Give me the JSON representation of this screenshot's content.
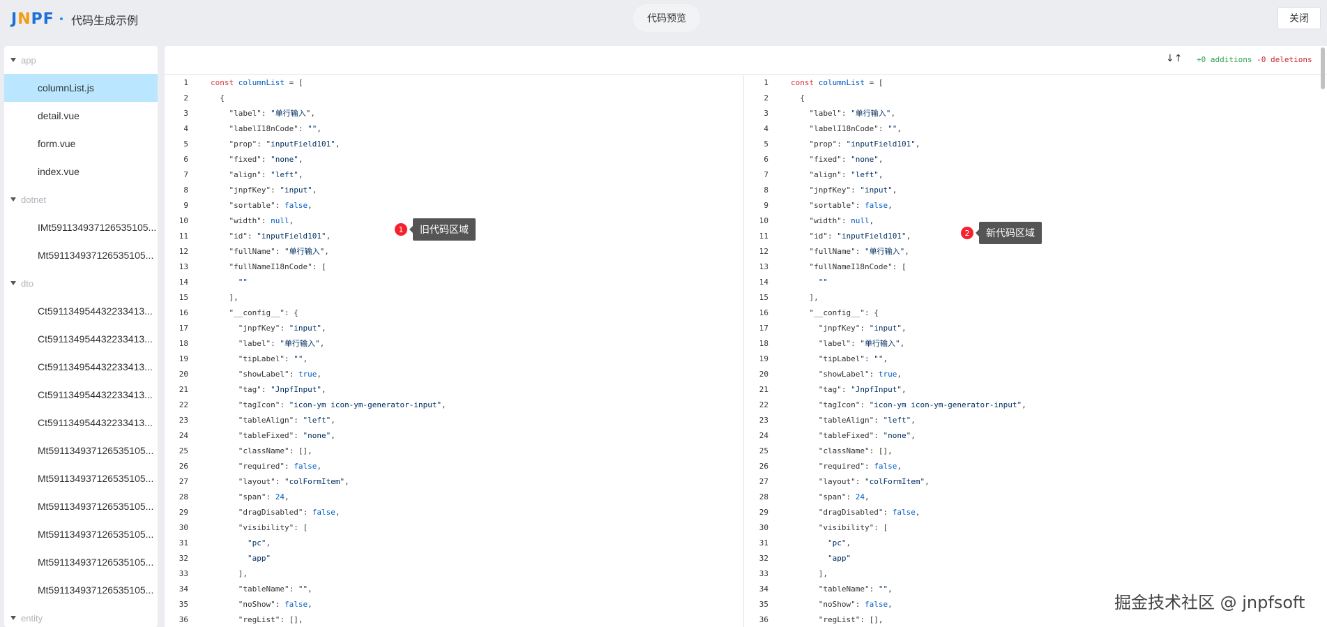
{
  "header": {
    "logo": {
      "l1": "J",
      "l2": "N",
      "l3": "PF"
    },
    "title": "代码生成示例",
    "preview_label": "代码预览",
    "close_label": "关闭"
  },
  "tree": {
    "folders": [
      {
        "name": "app",
        "files": [
          "columnList.js",
          "detail.vue",
          "form.vue",
          "index.vue"
        ]
      },
      {
        "name": "dotnet",
        "files": [
          "IMt591134937126535105...",
          "Mt591134937126535105..."
        ]
      },
      {
        "name": "dto",
        "files": [
          "Ct591134954432233413...",
          "Ct591134954432233413...",
          "Ct591134954432233413...",
          "Ct591134954432233413...",
          "Ct591134954432233413...",
          "Mt591134937126535105...",
          "Mt591134937126535105...",
          "Mt591134937126535105...",
          "Mt591134937126535105...",
          "Mt591134937126535105...",
          "Mt591134937126535105..."
        ]
      },
      {
        "name": "entity",
        "files": []
      }
    ],
    "active_file": "columnList.js"
  },
  "diff": {
    "arrows": "↓↑",
    "additions": "+0 additions",
    "deletions": "-0 deletions"
  },
  "annotations": {
    "old": {
      "num": "1",
      "label": "旧代码区域"
    },
    "new": {
      "num": "2",
      "label": "新代码区域"
    }
  },
  "code_lines": [
    [
      [
        "kw",
        "const"
      ],
      [
        "t",
        " "
      ],
      [
        "vn",
        "columnList"
      ],
      [
        "t",
        " = ["
      ]
    ],
    [
      [
        "t",
        "  {"
      ]
    ],
    [
      [
        "t",
        "    \"label\": "
      ],
      [
        "str",
        "\"单行输入\""
      ],
      [
        "t",
        ","
      ]
    ],
    [
      [
        "t",
        "    \"labelI18nCode\": "
      ],
      [
        "str",
        "\"\""
      ],
      [
        "t",
        ","
      ]
    ],
    [
      [
        "t",
        "    \"prop\": "
      ],
      [
        "str",
        "\"inputField101\""
      ],
      [
        "t",
        ","
      ]
    ],
    [
      [
        "t",
        "    \"fixed\": "
      ],
      [
        "str",
        "\"none\""
      ],
      [
        "t",
        ","
      ]
    ],
    [
      [
        "t",
        "    \"align\": "
      ],
      [
        "str",
        "\"left\""
      ],
      [
        "t",
        ","
      ]
    ],
    [
      [
        "t",
        "    \"jnpfKey\": "
      ],
      [
        "str",
        "\"input\""
      ],
      [
        "t",
        ","
      ]
    ],
    [
      [
        "t",
        "    \"sortable\": "
      ],
      [
        "lit",
        "false"
      ],
      [
        "t",
        ","
      ]
    ],
    [
      [
        "t",
        "    \"width\": "
      ],
      [
        "lit",
        "null"
      ],
      [
        "t",
        ","
      ]
    ],
    [
      [
        "t",
        "    \"id\": "
      ],
      [
        "str",
        "\"inputField101\""
      ],
      [
        "t",
        ","
      ]
    ],
    [
      [
        "t",
        "    \"fullName\": "
      ],
      [
        "str",
        "\"单行输入\""
      ],
      [
        "t",
        ","
      ]
    ],
    [
      [
        "t",
        "    \"fullNameI18nCode\": ["
      ]
    ],
    [
      [
        "t",
        "      "
      ],
      [
        "str",
        "\"\""
      ]
    ],
    [
      [
        "t",
        "    ],"
      ]
    ],
    [
      [
        "t",
        "    \"__config__\": {"
      ]
    ],
    [
      [
        "t",
        "      \"jnpfKey\": "
      ],
      [
        "str",
        "\"input\""
      ],
      [
        "t",
        ","
      ]
    ],
    [
      [
        "t",
        "      \"label\": "
      ],
      [
        "str",
        "\"单行输入\""
      ],
      [
        "t",
        ","
      ]
    ],
    [
      [
        "t",
        "      \"tipLabel\": "
      ],
      [
        "str",
        "\"\""
      ],
      [
        "t",
        ","
      ]
    ],
    [
      [
        "t",
        "      \"showLabel\": "
      ],
      [
        "lit",
        "true"
      ],
      [
        "t",
        ","
      ]
    ],
    [
      [
        "t",
        "      \"tag\": "
      ],
      [
        "str",
        "\"JnpfInput\""
      ],
      [
        "t",
        ","
      ]
    ],
    [
      [
        "t",
        "      \"tagIcon\": "
      ],
      [
        "str",
        "\"icon-ym icon-ym-generator-input\""
      ],
      [
        "t",
        ","
      ]
    ],
    [
      [
        "t",
        "      \"tableAlign\": "
      ],
      [
        "str",
        "\"left\""
      ],
      [
        "t",
        ","
      ]
    ],
    [
      [
        "t",
        "      \"tableFixed\": "
      ],
      [
        "str",
        "\"none\""
      ],
      [
        "t",
        ","
      ]
    ],
    [
      [
        "t",
        "      \"className\": [],"
      ]
    ],
    [
      [
        "t",
        "      \"required\": "
      ],
      [
        "lit",
        "false"
      ],
      [
        "t",
        ","
      ]
    ],
    [
      [
        "t",
        "      \"layout\": "
      ],
      [
        "str",
        "\"colFormItem\""
      ],
      [
        "t",
        ","
      ]
    ],
    [
      [
        "t",
        "      \"span\": "
      ],
      [
        "num",
        "24"
      ],
      [
        "t",
        ","
      ]
    ],
    [
      [
        "t",
        "      \"dragDisabled\": "
      ],
      [
        "lit",
        "false"
      ],
      [
        "t",
        ","
      ]
    ],
    [
      [
        "t",
        "      \"visibility\": ["
      ]
    ],
    [
      [
        "t",
        "        "
      ],
      [
        "str",
        "\"pc\""
      ],
      [
        "t",
        ","
      ]
    ],
    [
      [
        "t",
        "        "
      ],
      [
        "str",
        "\"app\""
      ]
    ],
    [
      [
        "t",
        "      ],"
      ]
    ],
    [
      [
        "t",
        "      \"tableName\": "
      ],
      [
        "str",
        "\"\""
      ],
      [
        "t",
        ","
      ]
    ],
    [
      [
        "t",
        "      \"noShow\": "
      ],
      [
        "lit",
        "false"
      ],
      [
        "t",
        ","
      ]
    ],
    [
      [
        "t",
        "      \"regList\": [],"
      ]
    ]
  ],
  "watermark": "掘金技术社区 @ jnpfsoft"
}
